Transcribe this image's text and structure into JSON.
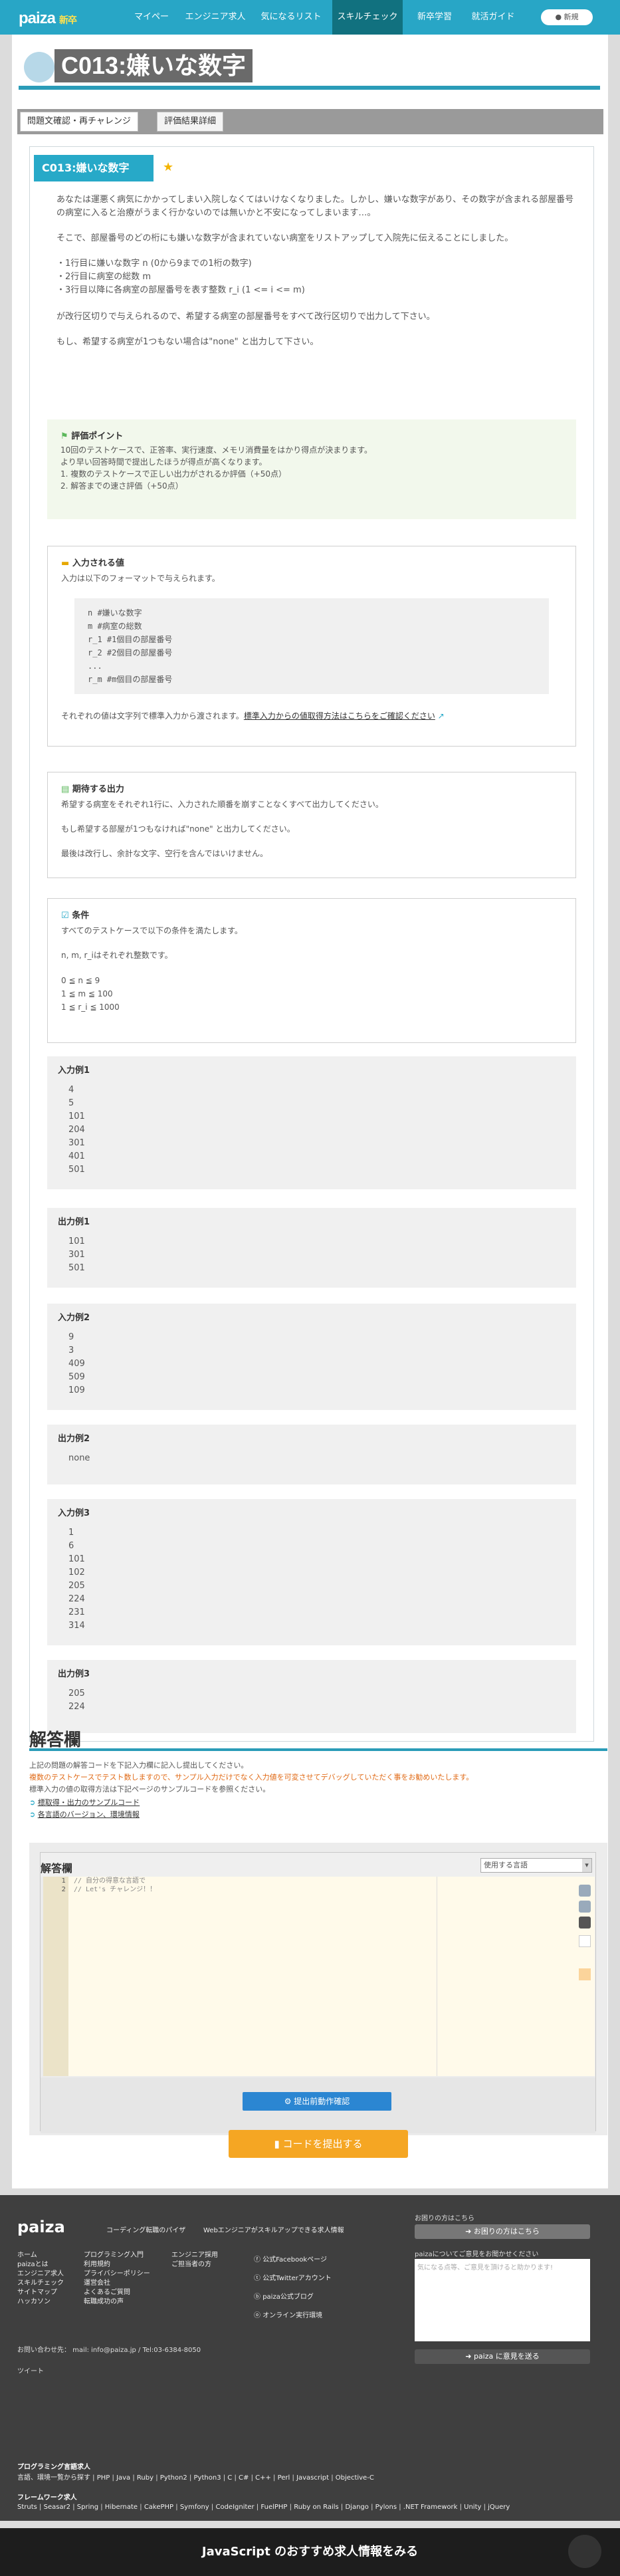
{
  "header": {
    "logo": "paiza",
    "logo_sub": "新卒",
    "nav": [
      "マイページ",
      "エンジニア求人",
      "気になるリスト",
      "スキルチェック",
      "新卒学習",
      "就活ガイド"
    ],
    "active_nav": "スキルチェック",
    "login": "新規"
  },
  "title": "C013:嫌いな数字",
  "tabs": [
    "問題文確認・再チャレンジ",
    "評価結果詳細"
  ],
  "problem": {
    "label": "C013:嫌いな数字",
    "intro1": "あなたは運悪く病気にかかってしまい入院しなくてはいけなくなりました。しかし、嫌いな数字があり、その数字が含まれる部屋番号の病室に入ると治療がうまく行かないのでは無いかと不安になってしまいます…。",
    "intro2": "そこで、部屋番号のどの桁にも嫌いな数字が含まれていない病室をリストアップして入院先に伝えることにしました。",
    "list": [
      "・1行目に嫌いな数字 n (0から9までの1桁の数字)",
      "・2行目に病室の総数 m",
      "・3行目以降に各病室の部屋番号を表す整数 r_i (1 <= i <= m)"
    ],
    "intro3": "が改行区切りで与えられるので、希望する病室の部屋番号をすべて改行区切りで出力して下さい。",
    "intro4": "もし、希望する病室が1つもない場合は\"none\" と出力して下さい。"
  },
  "eval": {
    "title": "評価ポイント",
    "body": "10回のテストケースで、正答率、実行速度、メモリ消費量をはかり得点が決まります。\nより早い回答時間で提出したほうが得点が高くなります。",
    "items": [
      "1. 複数のテストケースで正しい出力がされるか評価（+50点）",
      "2. 解答までの速さ評価（+50点）"
    ]
  },
  "input": {
    "title": "入力される値",
    "desc": "入力は以下のフォーマットで与えられます。",
    "code": [
      "n #嫌いな数字",
      "m #病室の総数",
      "r_1 #1個目の部屋番号",
      "r_2 #2個目の部屋番号",
      "...",
      "r_m #m個目の部屋番号"
    ],
    "note": "それぞれの値は文字列で標準入力から渡されます。",
    "link": "標準入力からの値取得方法はこちらをご確認ください"
  },
  "output": {
    "title": "期待する出力",
    "l1": "希望する病室をそれぞれ1行に、入力された順番を崩すことなくすべて出力してください。",
    "l2": "もし希望する部屋が1つもなければ\"none\" と出力してください。",
    "l3": "最後は改行し、余計な文字、空行を含んではいけません。"
  },
  "conditions": {
    "title": "条件",
    "l1": "すべてのテストケースで以下の条件を満たします。",
    "l2": "n, m, r_iはそれぞれ整数です。",
    "c": [
      "0 ≦ n ≦ 9",
      "1 ≦ m ≦ 100",
      "1 ≦ r_i ≦ 1000"
    ]
  },
  "examples": [
    {
      "label": "入力例1",
      "values": [
        "4",
        "5",
        "101",
        "204",
        "301",
        "401",
        "501"
      ]
    },
    {
      "label": "出力例1",
      "values": [
        "101",
        "301",
        "501"
      ]
    },
    {
      "label": "入力例2",
      "values": [
        "9",
        "3",
        "409",
        "509",
        "109"
      ]
    },
    {
      "label": "出力例2",
      "values": [
        "none"
      ]
    },
    {
      "label": "入力例3",
      "values": [
        "1",
        "6",
        "101",
        "102",
        "205",
        "224",
        "231",
        "314"
      ]
    },
    {
      "label": "出力例3",
      "values": [
        "205",
        "224"
      ]
    }
  ],
  "answer": {
    "title": "解答欄",
    "n1": "上記の問題の解答コードを下記入力欄に記入し提出してください。",
    "warn": "複数のテストケースでテスト数しますので、サンプル入力だけでなく入力値を可変させてデバッグしていただく事をお勧めいたします。",
    "n2": "標準入力の値の取得方法は下記ページのサンプルコードを参照ください。",
    "link1": "標取得・出力のサンプルコード",
    "link2": "各言語のバージョン、環境情報",
    "editor_title": "解答欄",
    "lang_placeholder": "使用する言語",
    "code_lines": [
      "// 自分の得意な言語で",
      "// Let's チャレンジ！！"
    ],
    "check_btn": "提出前動作確認",
    "submit_btn": "コードを提出する"
  },
  "footer": {
    "logo": "paiza",
    "tag": "コーディング転職のパイザ",
    "tag2": "Webエンジニアがスキルアップできる求人情報",
    "col1": [
      "ホーム",
      "paizaとは",
      "エンジニア求人",
      "スキルチェック",
      "サイトマップ",
      "ハッカソン"
    ],
    "col2": [
      "プログラミング入門",
      "利用規約",
      "プライバシーポリシー",
      "運営会社",
      "よくあるご質問",
      "転職成功の声"
    ],
    "col3": [
      "エンジニア採用",
      "ご担当者の方"
    ],
    "social": [
      "公式Facebookページ",
      "公式Twitterアカウント",
      "paiza公式ブログ",
      "オンライン実行環境"
    ],
    "contact": "お問い合わせ先： mail: info@paiza.jp / Tel:03-6384-8050",
    "tweet": "ツイート",
    "help": "お困りの方はこちら",
    "help_btn": "お困りの方はこちら",
    "opinion": "paizaについてご意見をお聞かせください",
    "opinion_ph": "気になる点等、ご意見を頂けると助かります!",
    "opinion_btn": "paiza に意見を送る",
    "lang_title": "プログラミング言語求人",
    "langs": [
      "言語、環境一覧から探す",
      "PHP",
      "Java",
      "Ruby",
      "Python2",
      "Python3",
      "C",
      "C#",
      "C++",
      "Perl",
      "Javascript",
      "Objective-C"
    ],
    "fw_title": "フレームワーク求人",
    "fws": [
      "Struts",
      "Seasar2",
      "Spring",
      "Hibernate",
      "CakePHP",
      "Symfony",
      "CodeIgniter",
      "FuelPHP",
      "Ruby on Rails",
      "Django",
      "Pylons",
      ".NET Framework",
      "Unity",
      "jQuery"
    ]
  },
  "bottom_bar": "JavaScript のおすすめ求人情報をみる"
}
